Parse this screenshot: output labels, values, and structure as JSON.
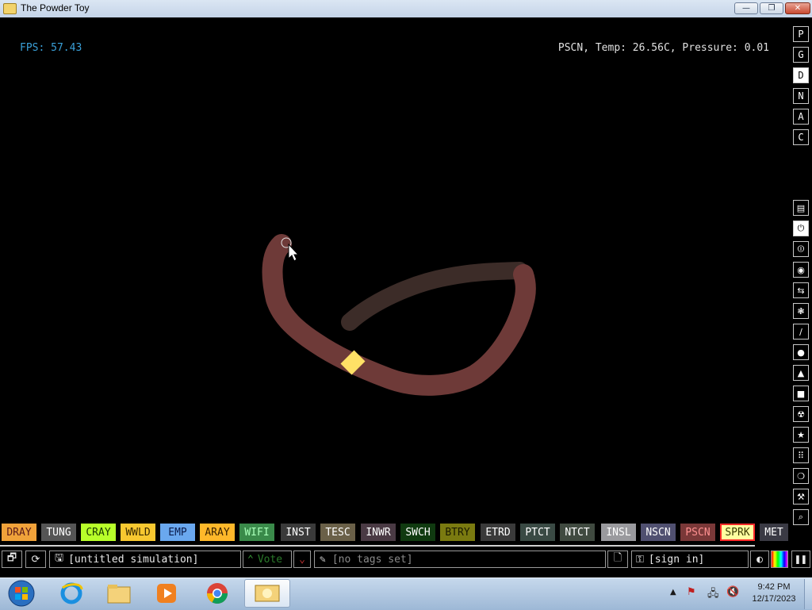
{
  "window": {
    "title": "The Powder Toy",
    "minimize_label": "—",
    "maximize_label": "❐",
    "close_label": "✕"
  },
  "hud": {
    "fps": "FPS: 57.43",
    "info": "PSCN, Temp: 26.56C, Pressure: 0.01"
  },
  "menu_buttons": [
    {
      "label": "P",
      "on": false
    },
    {
      "label": "G",
      "on": false
    },
    {
      "label": "D",
      "on": true
    },
    {
      "label": "N",
      "on": false
    },
    {
      "label": "A",
      "on": false
    },
    {
      "label": "C",
      "on": false
    }
  ],
  "tool_icons": [
    "wall-icon",
    "electronics-plug-icon",
    "power-icon",
    "explosive-icon",
    "sensor-icon",
    "gas-icon",
    "liquid-icon",
    "drop-icon",
    "powder-icon",
    "solid-icon",
    "radioactive-icon",
    "special-icon",
    "particles-icon",
    "life-icon",
    "tools-icon",
    "search-icon"
  ],
  "elements": [
    {
      "label": "DRAY",
      "bg": "#f0a23a",
      "fg": "#5a1a1a"
    },
    {
      "label": "TUNG",
      "bg": "#555555",
      "fg": "#ffffff"
    },
    {
      "label": "CRAY",
      "bg": "#b8ff2a",
      "fg": "#1a3a00"
    },
    {
      "label": "WWLD",
      "bg": "#f8c830",
      "fg": "#3a2a00"
    },
    {
      "label": "EMP",
      "bg": "#6aa8ef",
      "fg": "#0a1a4a"
    },
    {
      "label": "ARAY",
      "bg": "#ffb82a",
      "fg": "#3a2200"
    },
    {
      "label": "WIFI",
      "bg": "#3a8a4a",
      "fg": "#a8ffb8"
    },
    {
      "label": "INST",
      "bg": "#3a3a3a",
      "fg": "#ffffff"
    },
    {
      "label": "TESC",
      "bg": "#6a6048",
      "fg": "#ffffff"
    },
    {
      "label": "INWR",
      "bg": "#4a3a44",
      "fg": "#ffffff"
    },
    {
      "label": "SWCH",
      "bg": "#103a10",
      "fg": "#ffffff"
    },
    {
      "label": "BTRY",
      "bg": "#7a7a10",
      "fg": "#1a1a00"
    },
    {
      "label": "ETRD",
      "bg": "#3a3a3a",
      "fg": "#ffffff"
    },
    {
      "label": "PTCT",
      "bg": "#3a4a44",
      "fg": "#ffffff"
    },
    {
      "label": "NTCT",
      "bg": "#404a40",
      "fg": "#ffffff"
    },
    {
      "label": "INSL",
      "bg": "#9a9a9e",
      "fg": "#ffffff"
    },
    {
      "label": "NSCN",
      "bg": "#505070",
      "fg": "#ffffff"
    },
    {
      "label": "PSCN",
      "bg": "#7a3838",
      "fg": "#ff9090"
    },
    {
      "label": "SPRK",
      "bg": "#ffffa0",
      "fg": "#3a3a00",
      "selected": true
    },
    {
      "label": "MET",
      "bg": "#3a3a44",
      "fg": "#ffffff"
    }
  ],
  "status": {
    "sim_title": "[untitled simulation]",
    "vote_label": "Vote",
    "tags_placeholder": "[no tags set]",
    "sign_in_label": "[sign in]"
  },
  "taskbar": {
    "time": "9:42 PM",
    "date": "12/17/2023",
    "apps": [
      "start-orb",
      "internet-explorer-icon",
      "file-explorer-icon",
      "media-player-icon",
      "chrome-icon",
      "powder-toy-icon"
    ]
  },
  "colors": {
    "pscn": "#6e3a38",
    "nscn": "#3c2c28",
    "spark": "#ffe066",
    "fps": "#3aa0d8"
  }
}
